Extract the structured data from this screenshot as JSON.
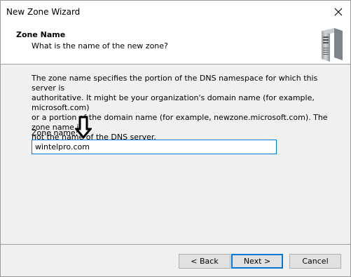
{
  "window": {
    "title": "New Zone Wizard"
  },
  "header": {
    "title": "Zone Name",
    "subtitle": "What is the name of the new zone?"
  },
  "body": {
    "description_lines": [
      "The zone name specifies the portion of the DNS namespace for which this server is",
      "authoritative. It might be your organization's domain name (for example,  microsoft.com)",
      "or a portion of the domain name (for example, newzone.microsoft.com). The zone name is",
      "not the name of the DNS server."
    ],
    "zone_name_label": "Zone name:",
    "zone_name_value": "wintelpro.com"
  },
  "buttons": {
    "back": "< Back",
    "next": "Next >",
    "cancel": "Cancel"
  },
  "icons": {
    "close": "close-icon",
    "server": "server-icon",
    "annotation_arrow": "down-arrow-icon"
  },
  "colors": {
    "accent": "#0078d7",
    "window_bg": "#f0f0f0",
    "header_bg": "#ffffff"
  }
}
